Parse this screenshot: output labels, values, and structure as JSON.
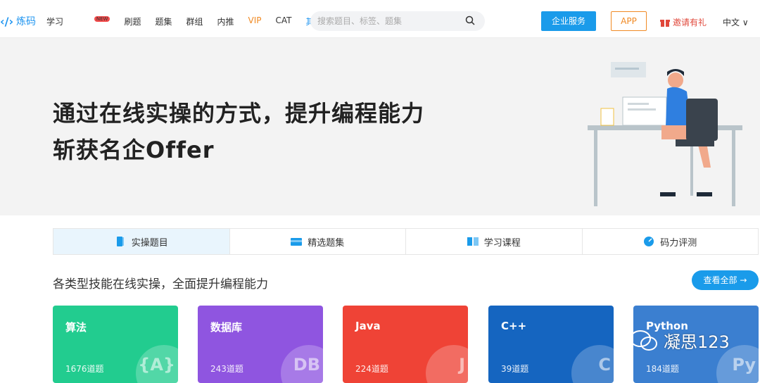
{
  "nav": {
    "logo_text": "炼码",
    "items": [
      {
        "label": "学习",
        "style": "orange",
        "badge": "NEW"
      },
      {
        "label": "刷题",
        "style": "normal"
      },
      {
        "label": "题集",
        "style": "normal"
      },
      {
        "label": "群组",
        "style": "normal"
      },
      {
        "label": "内推",
        "style": "normal"
      },
      {
        "label": "VIP",
        "style": "orange"
      },
      {
        "label": "CAT",
        "style": "normal"
      },
      {
        "label": "其他...",
        "style": "blue"
      }
    ],
    "search_placeholder": "搜索题目、标签、题集",
    "enterprise_label": "企业服务",
    "app_label": "APP",
    "invite_label": "邀请有礼",
    "lang_label": "中文"
  },
  "hero": {
    "line1": "通过在线实操的方式，提升编程能力",
    "line2": "斩获名企Offer"
  },
  "tabs": [
    {
      "label": "实操题目",
      "active": true,
      "icon": "book-icon"
    },
    {
      "label": "精选题集",
      "active": false,
      "icon": "folder-icon"
    },
    {
      "label": "学习课程",
      "active": false,
      "icon": "open-book-icon"
    },
    {
      "label": "码力评测",
      "active": false,
      "icon": "gauge-icon"
    }
  ],
  "section": {
    "title": "各类型技能在线实操，全面提升编程能力",
    "view_all_label": "查看全部"
  },
  "cards": [
    {
      "name": "算法",
      "count": "1676道题",
      "color": "#22cc8f",
      "glyph": "{A}"
    },
    {
      "name": "数据库",
      "count": "243道题",
      "color": "#8f55e0",
      "glyph": "DB"
    },
    {
      "name": "Java",
      "count": "224道题",
      "color": "#ef4336",
      "glyph": "J"
    },
    {
      "name": "C++",
      "count": "39道题",
      "color": "#1565c0",
      "glyph": "C"
    },
    {
      "name": "Python",
      "count": "184道题",
      "color": "#3b7fd0",
      "glyph": "Py"
    }
  ],
  "watermark": {
    "text": "凝思123"
  },
  "colors": {
    "accent": "#1a9bea",
    "orange": "#f08a24",
    "red": "#e0473a"
  }
}
